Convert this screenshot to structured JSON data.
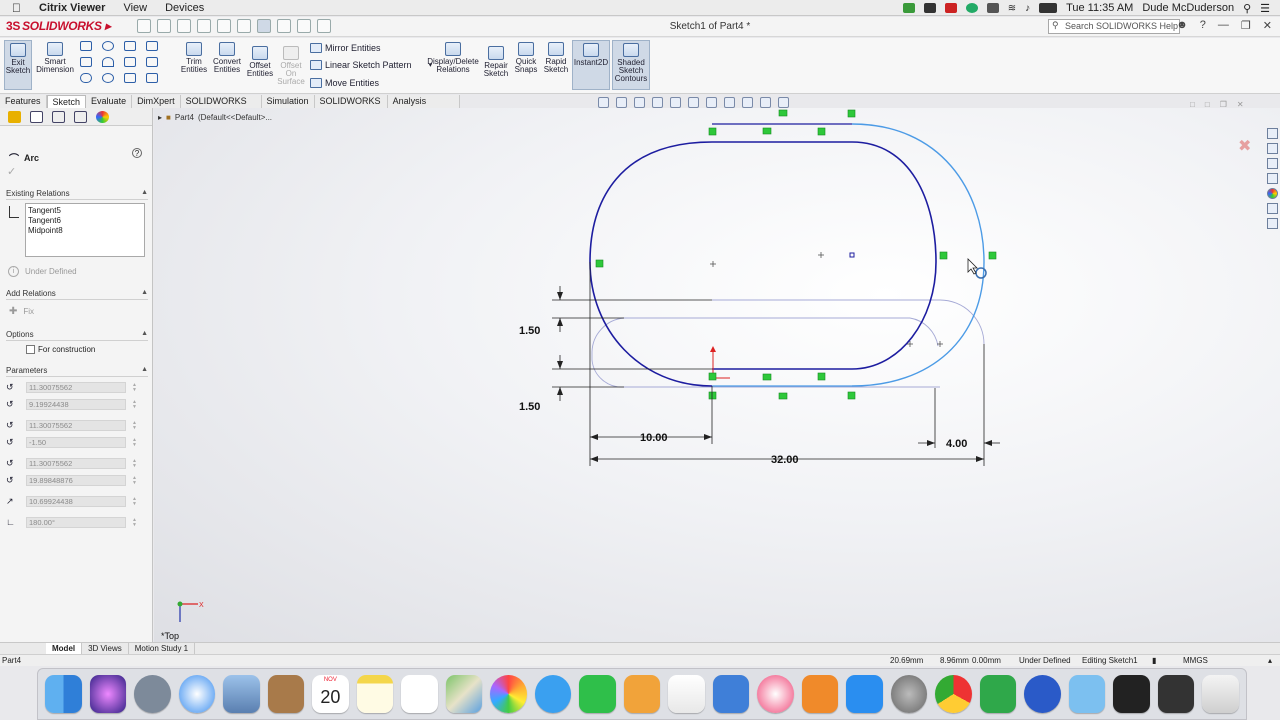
{
  "menubar": {
    "app_name": "Citrix Viewer",
    "menus": [
      "View",
      "Devices"
    ],
    "clock": "Tue 11:35 AM",
    "user": "Dude McDuderson"
  },
  "titlebar": {
    "brand": "SOLIDWORKS",
    "document_title": "Sketch1 of Part4 *",
    "search_placeholder": "Search SOLIDWORKS Help"
  },
  "commands": {
    "exit_sketch": "Exit Sketch",
    "smart_dimension": "Smart Dimension",
    "trim_entities": "Trim Entities",
    "convert_entities": "Convert Entities",
    "offset_entities": "Offset Entities",
    "offset_on_surface": "Offset On Surface",
    "mirror_entities": "Mirror Entities",
    "linear_sketch_pattern": "Linear Sketch Pattern",
    "move_entities": "Move Entities",
    "display_delete_relations": "Display/Delete Relations",
    "repair_sketch": "Repair Sketch",
    "quick_snaps": "Quick Snaps",
    "rapid_sketch": "Rapid Sketch",
    "instant2d": "Instant2D",
    "shaded_sketch_contours": "Shaded Sketch Contours"
  },
  "tabs": [
    "Features",
    "Sketch",
    "Evaluate",
    "DimXpert",
    "SOLIDWORKS Add-Ins",
    "Simulation",
    "SOLIDWORKS MBD",
    "Analysis Preparation"
  ],
  "active_tab": "Sketch",
  "property_manager": {
    "title": "Arc",
    "existing_relations_header": "Existing Relations",
    "relations": [
      "Tangent5",
      "Tangent6",
      "Midpoint8"
    ],
    "status": "Under Defined",
    "add_relations_header": "Add Relations",
    "fix_label": "Fix",
    "options_header": "Options",
    "for_construction": "For construction",
    "parameters_header": "Parameters",
    "parameters": [
      "11.30075562",
      "9.19924438",
      "11.30075562",
      "-1.50",
      "11.30075562",
      "19.89848876",
      "10.69924438",
      "180.00°"
    ]
  },
  "feature_tree": {
    "part": "Part4",
    "config": "(Default<<Default>..."
  },
  "sketch": {
    "dimensions": {
      "offset_top": "1.50",
      "offset_bottom": "1.50",
      "length_left": "10.00",
      "length_right": "4.00",
      "overall": "32.00"
    },
    "view_label": "*Top",
    "colors": {
      "selected": "#1a1aa8",
      "preview": "#4c9be6",
      "relation": "#22cc33",
      "construction": "#9aa0d8"
    }
  },
  "bottom_tabs": [
    "Model",
    "3D Views",
    "Motion Study 1"
  ],
  "status_bar": {
    "part": "Part4",
    "x": "20.69mm",
    "y": "8.96mm",
    "z": "0.00mm",
    "state": "Under Defined",
    "editing": "Editing Sketch1",
    "units": "MMGS"
  },
  "dock": {
    "calendar_month": "NOV",
    "calendar_day": "20"
  }
}
